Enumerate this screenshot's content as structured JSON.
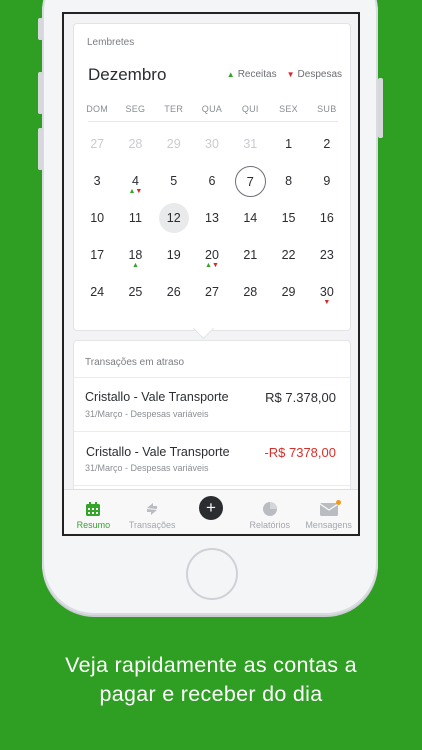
{
  "colors": {
    "background": "#2e9f22",
    "accent_green": "#35a52a",
    "expense_red": "#d42a2a"
  },
  "calendar": {
    "card_label": "Lembretes",
    "month": "Dezembro",
    "legend_income": "Receitas",
    "legend_expense": "Despesas",
    "weekdays": [
      "DOM",
      "SEG",
      "TER",
      "QUA",
      "QUI",
      "SEX",
      "SUB"
    ],
    "weeks": [
      [
        {
          "d": "27",
          "muted": true
        },
        {
          "d": "28",
          "muted": true
        },
        {
          "d": "29",
          "muted": true
        },
        {
          "d": "30",
          "muted": true
        },
        {
          "d": "31",
          "muted": true
        },
        {
          "d": "1"
        },
        {
          "d": "2"
        }
      ],
      [
        {
          "d": "3"
        },
        {
          "d": "4",
          "income": true,
          "expense": true
        },
        {
          "d": "5"
        },
        {
          "d": "6"
        },
        {
          "d": "7",
          "today": true
        },
        {
          "d": "8"
        },
        {
          "d": "9"
        }
      ],
      [
        {
          "d": "10"
        },
        {
          "d": "11"
        },
        {
          "d": "12",
          "selected": true
        },
        {
          "d": "13"
        },
        {
          "d": "14"
        },
        {
          "d": "15"
        },
        {
          "d": "16"
        }
      ],
      [
        {
          "d": "17"
        },
        {
          "d": "18",
          "income": true
        },
        {
          "d": "19"
        },
        {
          "d": "20",
          "income": true,
          "expense": true
        },
        {
          "d": "21"
        },
        {
          "d": "22"
        },
        {
          "d": "23"
        }
      ],
      [
        {
          "d": "24"
        },
        {
          "d": "25"
        },
        {
          "d": "26"
        },
        {
          "d": "27"
        },
        {
          "d": "28"
        },
        {
          "d": "29"
        },
        {
          "d": "30",
          "expense": true
        }
      ]
    ]
  },
  "overdue": {
    "card_label": "Transações em atraso",
    "items": [
      {
        "title": "Cristallo - Vale Transporte",
        "amount": "R$ 7.378,00",
        "subtitle": "31/Março - Despesas variáveis",
        "negative": false
      },
      {
        "title": "Cristallo - Vale Transporte",
        "amount": "-R$ 7378,00",
        "subtitle": "31/Março - Despesas variáveis",
        "negative": true
      }
    ]
  },
  "tabbar": {
    "tabs": [
      {
        "label": "Resumo",
        "icon": "calendar-icon",
        "active": true
      },
      {
        "label": "Transações",
        "icon": "transfer-arrows-icon",
        "active": false
      },
      {
        "label": "",
        "icon": "plus-icon",
        "active": false
      },
      {
        "label": "Relatórios",
        "icon": "pie-chart-icon",
        "active": false
      },
      {
        "label": "Mensagens",
        "icon": "envelope-icon",
        "active": false
      }
    ]
  },
  "caption": {
    "line1": "Veja rapidamente as contas a",
    "line2": "pagar e receber do dia"
  }
}
